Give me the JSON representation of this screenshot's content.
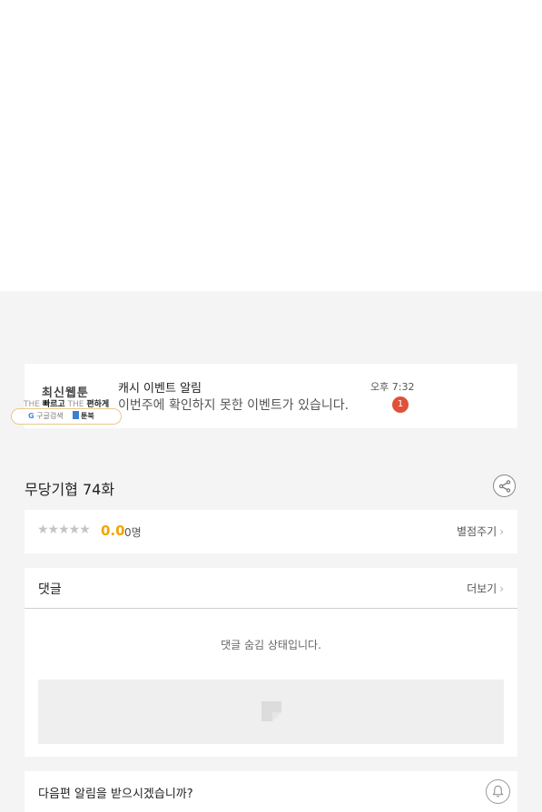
{
  "ad": {
    "title": "최신웹툰",
    "slogan_the1": "THE",
    "slogan_word1": "빠르고",
    "slogan_the2": "THE",
    "slogan_word2": "편하게",
    "google_g": "G",
    "google_label": "구글검색",
    "toonbook_label": "툰북"
  },
  "notification": {
    "title": "캐시 이벤트 알림",
    "body": "이번주에 확인하지 못한 이벤트가 있습니다.",
    "time": "오후 7:32",
    "badge_count": "1"
  },
  "episode": {
    "title": "무당기협 74화",
    "share_icon": "share-icon"
  },
  "rating": {
    "stars": "★★★★★",
    "score": "0.0",
    "count": "0명",
    "rate_link": "별점주기",
    "chevron": "›"
  },
  "comments": {
    "title": "댓글",
    "more_link": "더보기",
    "chevron": "›",
    "hidden_message": "댓글 숨김 상태입니다."
  },
  "next_episode": {
    "question": "다음편 알림을 받으시겠습니까?",
    "bell_icon": "bell-icon"
  },
  "colors": {
    "accent_score": "#f0a500",
    "badge_red": "#e0513a",
    "background_gray": "#f4f4f4"
  }
}
